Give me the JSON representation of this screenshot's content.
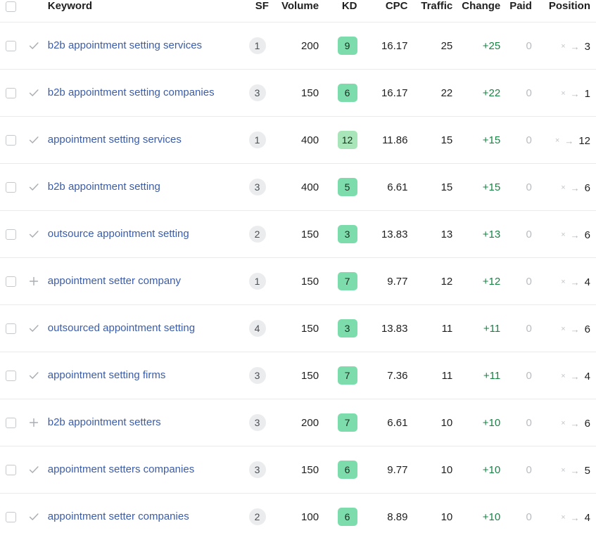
{
  "table": {
    "columns": {
      "keyword": "Keyword",
      "sf": "SF",
      "volume": "Volume",
      "kd": "KD",
      "cpc": "CPC",
      "traffic": "Traffic",
      "change": "Change",
      "paid": "Paid",
      "position": "Position"
    },
    "icons": {
      "check": "check-icon",
      "plus": "plus-icon",
      "position_x": "×",
      "position_arrow": "→"
    },
    "colors": {
      "link": "#3b5ca8",
      "change_positive": "#1a8245",
      "kd_easy": "#7ddcab",
      "kd_medium": "#a8e6b9",
      "sf_badge": "#ebecee",
      "row_divider": "#e9eaec",
      "muted": "#b9bcc0"
    },
    "rows": [
      {
        "selected": false,
        "status": "check",
        "keyword": "b2b appointment setting services",
        "sf": "1",
        "volume": "200",
        "kd": "9",
        "kd_color": "#7ddcab",
        "cpc": "16.17",
        "traffic": "25",
        "change": "+25",
        "paid": "0",
        "position": "3"
      },
      {
        "selected": false,
        "status": "check",
        "keyword": "b2b appointment setting companies",
        "sf": "3",
        "volume": "150",
        "kd": "6",
        "kd_color": "#7ddcab",
        "cpc": "16.17",
        "traffic": "22",
        "change": "+22",
        "paid": "0",
        "position": "1"
      },
      {
        "selected": false,
        "status": "check",
        "keyword": "appointment setting services",
        "sf": "1",
        "volume": "400",
        "kd": "12",
        "kd_color": "#a8e6b9",
        "cpc": "11.86",
        "traffic": "15",
        "change": "+15",
        "paid": "0",
        "position": "12"
      },
      {
        "selected": false,
        "status": "check",
        "keyword": "b2b appointment setting",
        "sf": "3",
        "volume": "400",
        "kd": "5",
        "kd_color": "#7ddcab",
        "cpc": "6.61",
        "traffic": "15",
        "change": "+15",
        "paid": "0",
        "position": "6"
      },
      {
        "selected": false,
        "status": "check",
        "keyword": "outsource appointment setting",
        "sf": "2",
        "volume": "150",
        "kd": "3",
        "kd_color": "#7ddcab",
        "cpc": "13.83",
        "traffic": "13",
        "change": "+13",
        "paid": "0",
        "position": "6"
      },
      {
        "selected": false,
        "status": "plus",
        "keyword": "appointment setter company",
        "sf": "1",
        "volume": "150",
        "kd": "7",
        "kd_color": "#7ddcab",
        "cpc": "9.77",
        "traffic": "12",
        "change": "+12",
        "paid": "0",
        "position": "4"
      },
      {
        "selected": false,
        "status": "check",
        "keyword": "outsourced appointment setting",
        "sf": "4",
        "volume": "150",
        "kd": "3",
        "kd_color": "#7ddcab",
        "cpc": "13.83",
        "traffic": "11",
        "change": "+11",
        "paid": "0",
        "position": "6"
      },
      {
        "selected": false,
        "status": "check",
        "keyword": "appointment setting firms",
        "sf": "3",
        "volume": "150",
        "kd": "7",
        "kd_color": "#7ddcab",
        "cpc": "7.36",
        "traffic": "11",
        "change": "+11",
        "paid": "0",
        "position": "4"
      },
      {
        "selected": false,
        "status": "plus",
        "keyword": "b2b appointment setters",
        "sf": "3",
        "volume": "200",
        "kd": "7",
        "kd_color": "#7ddcab",
        "cpc": "6.61",
        "traffic": "10",
        "change": "+10",
        "paid": "0",
        "position": "6"
      },
      {
        "selected": false,
        "status": "check",
        "keyword": "appointment setters companies",
        "sf": "3",
        "volume": "150",
        "kd": "6",
        "kd_color": "#7ddcab",
        "cpc": "9.77",
        "traffic": "10",
        "change": "+10",
        "paid": "0",
        "position": "5"
      },
      {
        "selected": false,
        "status": "check",
        "keyword": "appointment setter companies",
        "sf": "2",
        "volume": "100",
        "kd": "6",
        "kd_color": "#7ddcab",
        "cpc": "8.89",
        "traffic": "10",
        "change": "+10",
        "paid": "0",
        "position": "4"
      }
    ]
  }
}
